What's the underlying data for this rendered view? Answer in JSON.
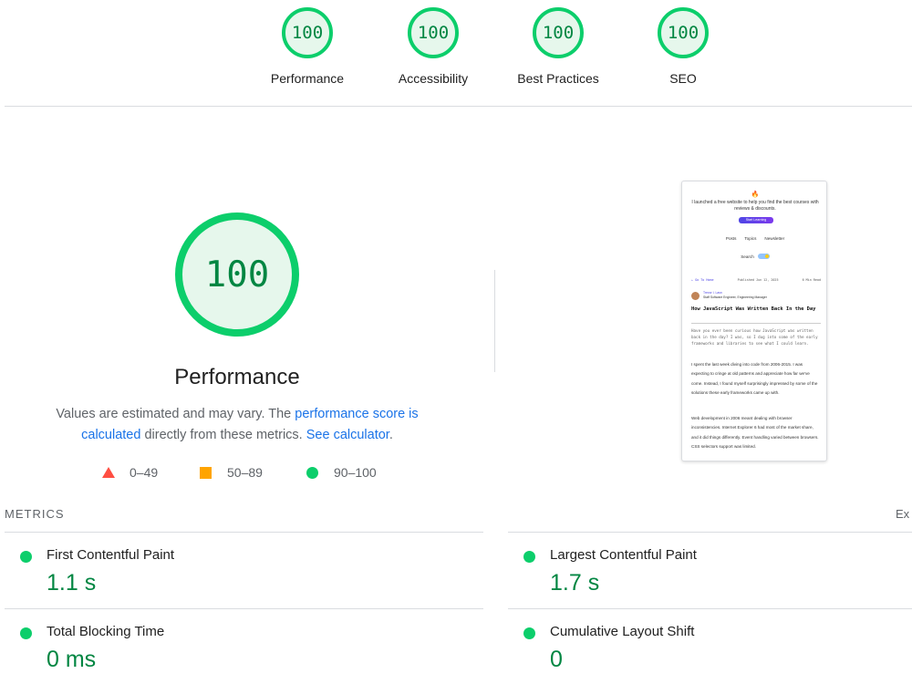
{
  "top_gauges": [
    {
      "score": "100",
      "label": "Performance"
    },
    {
      "score": "100",
      "label": "Accessibility"
    },
    {
      "score": "100",
      "label": "Best Practices"
    },
    {
      "score": "100",
      "label": "SEO"
    }
  ],
  "performance": {
    "score": "100",
    "title": "Performance",
    "desc_prefix": "Values are estimated and may vary. The ",
    "desc_link1": "performance score is calculated",
    "desc_middle": " directly from these metrics. ",
    "desc_link2": "See calculator",
    "desc_suffix": "."
  },
  "legend": {
    "fail": "0–49",
    "average": "50–89",
    "pass": "90–100"
  },
  "colors": {
    "pass": "#0cce6b",
    "pass_text": "#018642",
    "pass_bg": "#e6f7ec",
    "average": "#ffa400",
    "fail": "#ff4e42",
    "link": "#1a73e8"
  },
  "thumbnail": {
    "emoji": "🔥",
    "banner": "I launched a free website to help you find the best courses with reviews & discounts.",
    "button": "Start Learning",
    "nav": [
      "Posts",
      "Topics",
      "Newsletter"
    ],
    "search": "Search",
    "back": "← Go To Home",
    "published": "Published Jun 12, 2025",
    "read_time": "6 Min Read",
    "author_name": "Trevor I. Lasn",
    "author_role": "Staff Software Engineer, Engineering Manager",
    "title": "How JavaScript Was Written Back In the Day",
    "intro": "Have you ever been curious how JavaScript was written back in the day? I was, so I dug into some of the early frameworks and libraries to see what I could learn.",
    "para1": "I spent the last week diving into code from 2006-2015. I was expecting to cringe at old patterns and appreciate how far we've come. Instead, I found myself surprisingly impressed by some of the solutions these early frameworks came up with.",
    "para2": "Web development in 2006 meant dealing with browser inconsistencies. Internet Explorer 6 had most of the market share, and it did things differently. Event handling varied between browsers. CSS selectors support was limited."
  },
  "metrics": {
    "header": "METRICS",
    "expand": "Ex",
    "items": [
      {
        "name": "First Contentful Paint",
        "value": "1.1 s"
      },
      {
        "name": "Largest Contentful Paint",
        "value": "1.7 s"
      },
      {
        "name": "Total Blocking Time",
        "value": "0 ms"
      },
      {
        "name": "Cumulative Layout Shift",
        "value": "0"
      }
    ]
  }
}
